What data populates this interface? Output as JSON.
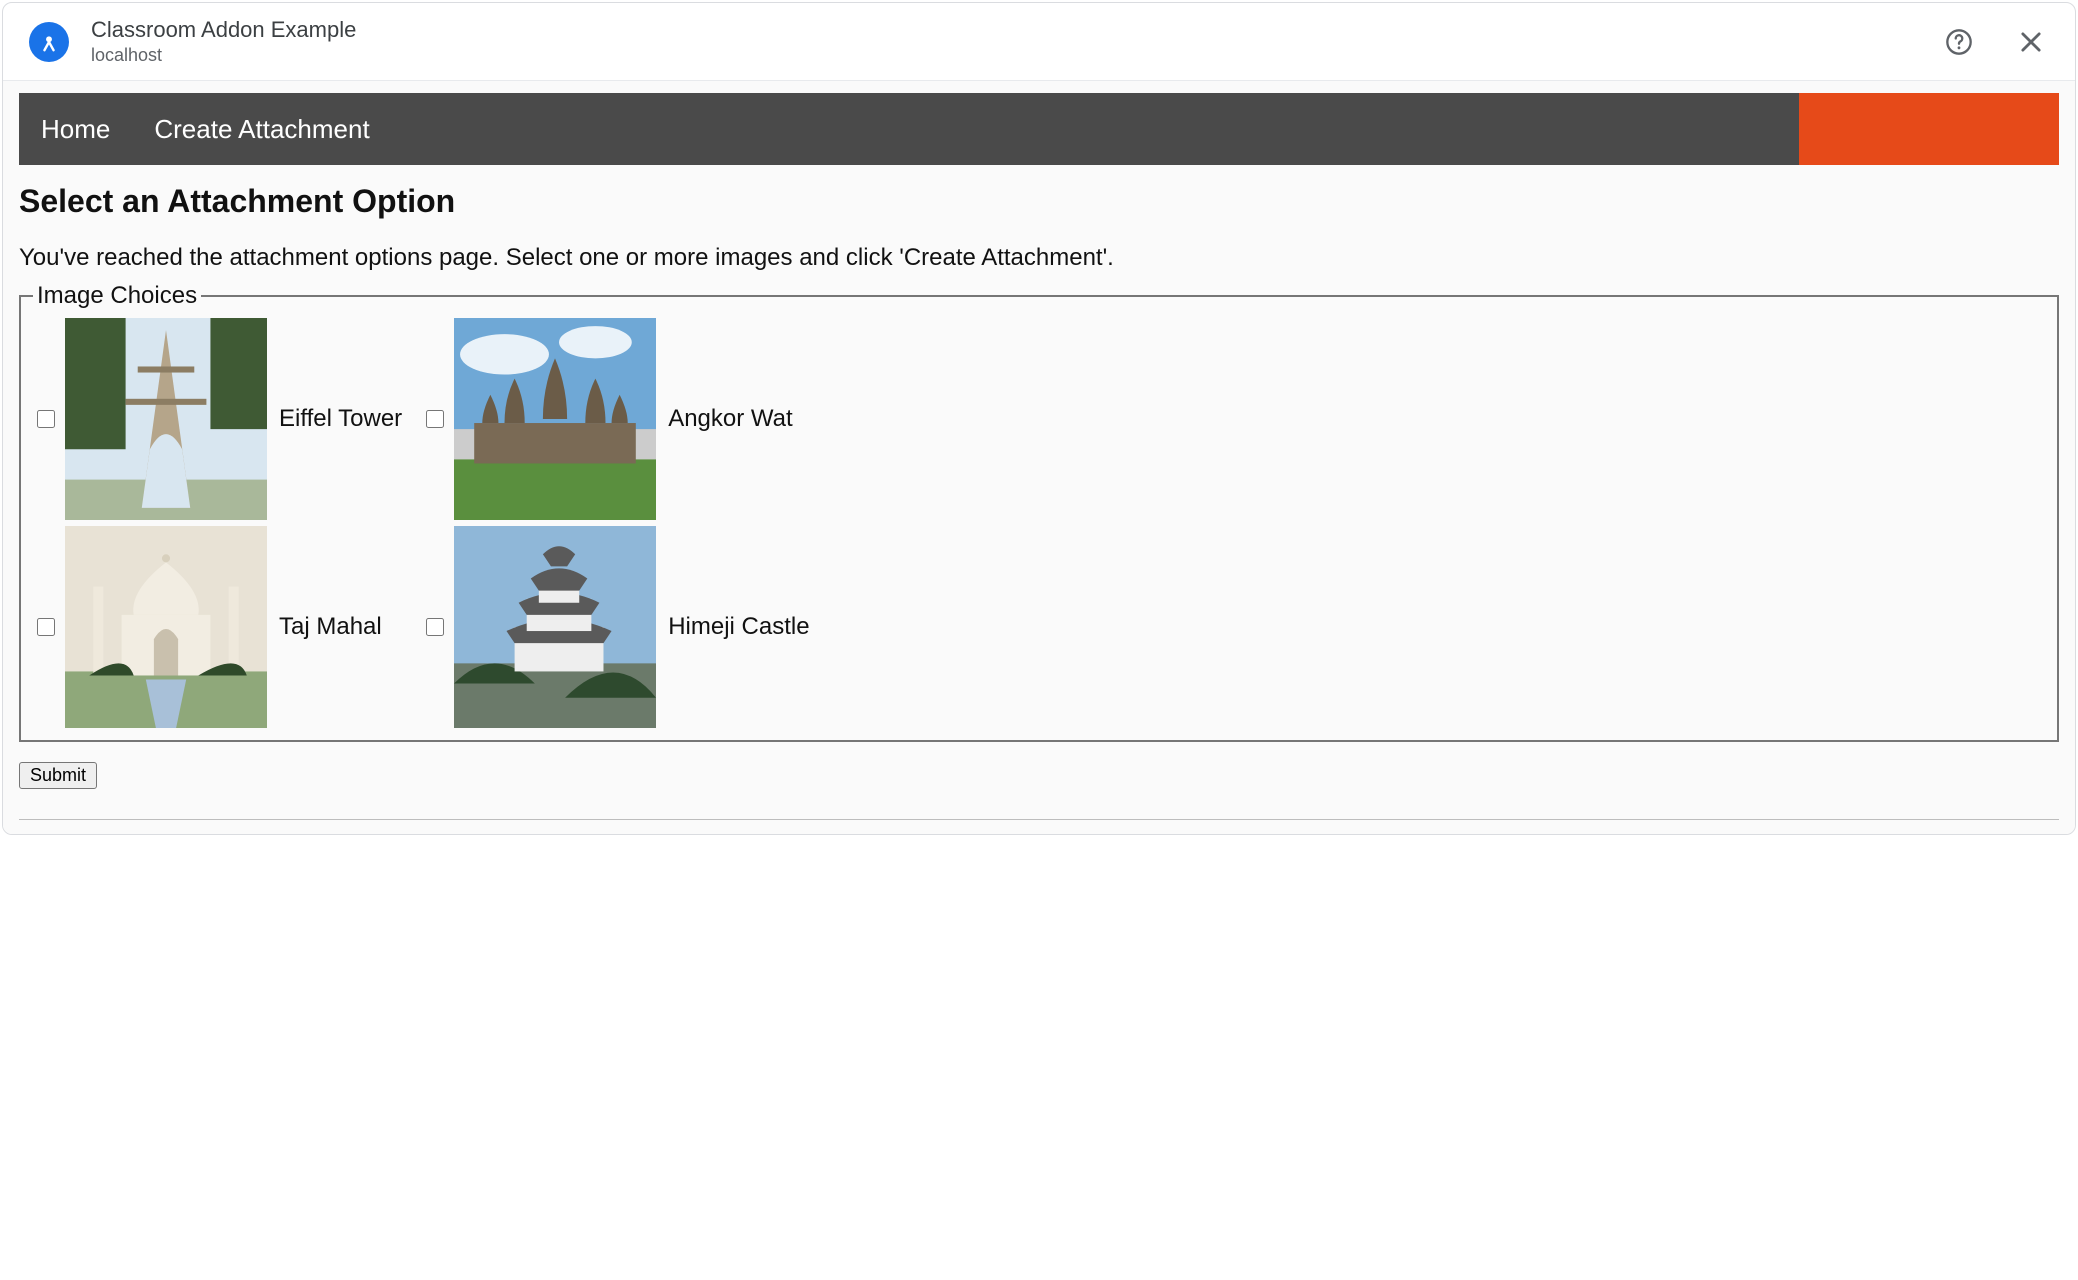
{
  "header": {
    "title": "Classroom Addon Example",
    "subtitle": "localhost"
  },
  "nav": {
    "home": "Home",
    "create": "Create Attachment"
  },
  "page": {
    "title": "Select an Attachment Option",
    "description": "You've reached the attachment options page. Select one or more images and click 'Create Attachment'.",
    "fieldset_legend": "Image Choices",
    "submit_label": "Submit"
  },
  "choices": [
    {
      "label": "Eiffel Tower"
    },
    {
      "label": "Angkor Wat"
    },
    {
      "label": "Taj Mahal"
    },
    {
      "label": "Himeji Castle"
    }
  ]
}
